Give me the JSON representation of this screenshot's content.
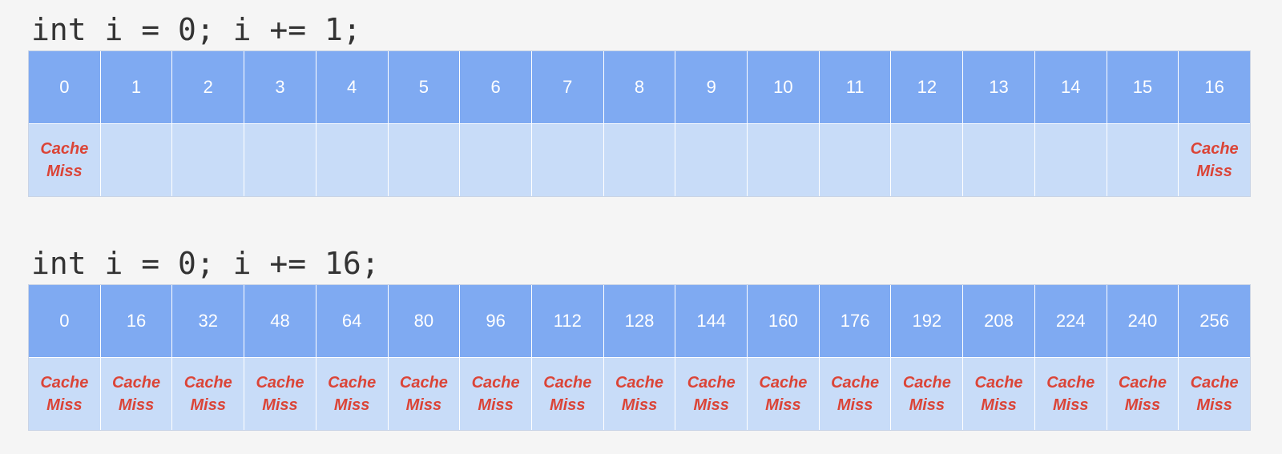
{
  "sections": [
    {
      "code": "int i = 0; i += 1;",
      "indices": [
        "0",
        "1",
        "2",
        "3",
        "4",
        "5",
        "6",
        "7",
        "8",
        "9",
        "10",
        "11",
        "12",
        "13",
        "14",
        "15",
        "16"
      ],
      "results": [
        "Cache Miss",
        "",
        "",
        "",
        "",
        "",
        "",
        "",
        "",
        "",
        "",
        "",
        "",
        "",
        "",
        "",
        "Cache Miss"
      ]
    },
    {
      "code": "int i = 0; i += 16;",
      "indices": [
        "0",
        "16",
        "32",
        "48",
        "64",
        "80",
        "96",
        "112",
        "128",
        "144",
        "160",
        "176",
        "192",
        "208",
        "224",
        "240",
        "256"
      ],
      "results": [
        "Cache Miss",
        "Cache Miss",
        "Cache Miss",
        "Cache Miss",
        "Cache Miss",
        "Cache Miss",
        "Cache Miss",
        "Cache Miss",
        "Cache Miss",
        "Cache Miss",
        "Cache Miss",
        "Cache Miss",
        "Cache Miss",
        "Cache Miss",
        "Cache Miss",
        "Cache Miss",
        "Cache Miss"
      ]
    }
  ],
  "colors": {
    "index_cell": "#7faaf2",
    "result_cell": "#c8dcf8",
    "miss_text": "#db4437"
  }
}
